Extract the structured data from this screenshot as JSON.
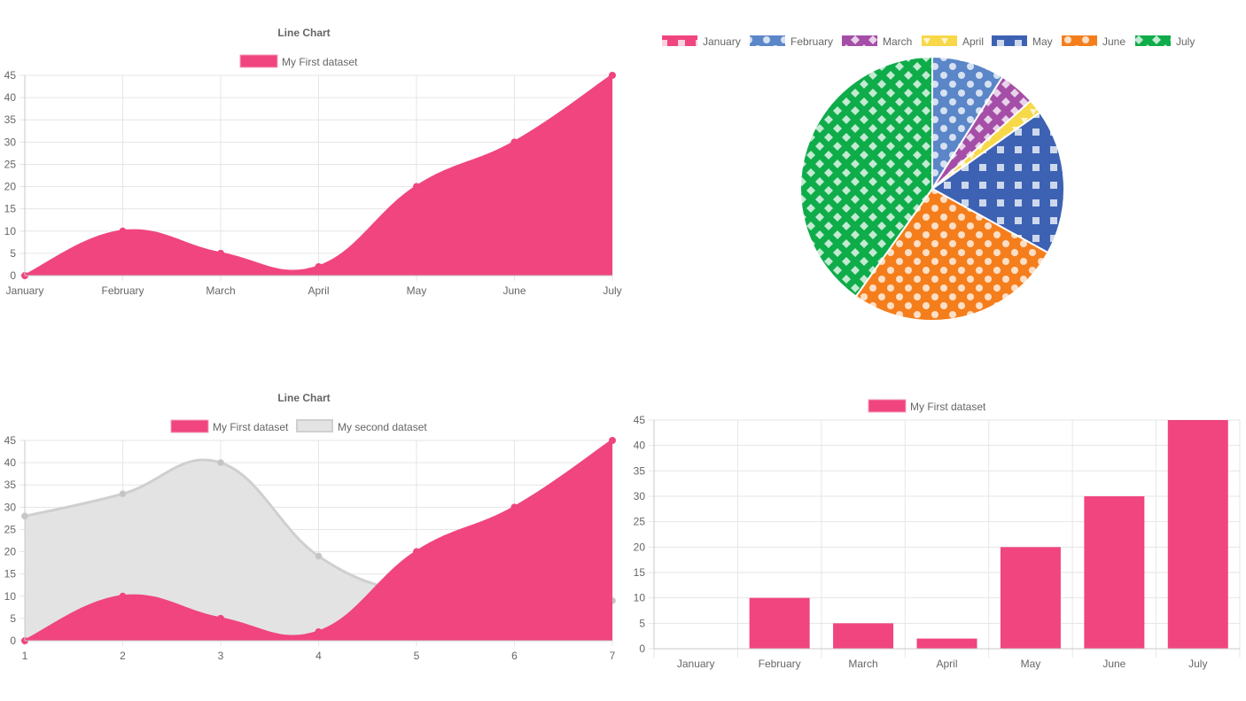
{
  "colors": {
    "pink": "#f0457f",
    "grey_fill": "#e3e3e3",
    "grey_line": "#cfcfcf",
    "pie": [
      "#f0457f",
      "#5b86c8",
      "#a54ea8",
      "#f7d848",
      "#3d62b3",
      "#f57e1c",
      "#0fac4a"
    ]
  },
  "chart_data": [
    {
      "id": "line-chart-top",
      "type": "area",
      "title": "Line Chart",
      "categories": [
        "January",
        "February",
        "March",
        "April",
        "May",
        "June",
        "July"
      ],
      "series": [
        {
          "name": "My First dataset",
          "values": [
            0,
            10,
            5,
            2,
            20,
            30,
            45
          ]
        }
      ],
      "yticks": [
        "0",
        "5",
        "10",
        "15",
        "20",
        "25",
        "30",
        "35",
        "40",
        "45"
      ],
      "ylim": [
        0,
        45
      ],
      "grid": true,
      "legend": "top"
    },
    {
      "id": "pie-chart",
      "type": "pie",
      "title": "",
      "labels": [
        "January",
        "February",
        "March",
        "April",
        "May",
        "June",
        "July"
      ],
      "values": [
        0,
        10,
        5,
        2,
        20,
        30,
        45
      ],
      "patterns": [
        "square",
        "dot",
        "diamond",
        "triangle",
        "square",
        "dot",
        "diamond"
      ],
      "legend": "top"
    },
    {
      "id": "line-chart-bottom",
      "type": "area",
      "title": "Line Chart",
      "categories": [
        "1",
        "2",
        "3",
        "4",
        "5",
        "6",
        "7"
      ],
      "series": [
        {
          "name": "My First dataset",
          "values": [
            0,
            10,
            5,
            2,
            20,
            30,
            45
          ]
        },
        {
          "name": "My second dataset",
          "values": [
            28,
            33,
            40,
            19,
            10,
            6,
            9
          ]
        }
      ],
      "yticks": [
        "0",
        "5",
        "10",
        "15",
        "20",
        "25",
        "30",
        "35",
        "40",
        "45"
      ],
      "ylim": [
        0,
        45
      ],
      "grid": true,
      "legend": "top"
    },
    {
      "id": "bar-chart",
      "type": "bar",
      "title": "",
      "categories": [
        "January",
        "February",
        "March",
        "April",
        "May",
        "June",
        "July"
      ],
      "series": [
        {
          "name": "My First dataset",
          "values": [
            0,
            10,
            5,
            2,
            20,
            30,
            45
          ]
        }
      ],
      "yticks": [
        "0",
        "5",
        "10",
        "15",
        "20",
        "25",
        "30",
        "35",
        "40",
        "45"
      ],
      "ylim": [
        0,
        45
      ],
      "grid": true,
      "legend": "top"
    }
  ]
}
